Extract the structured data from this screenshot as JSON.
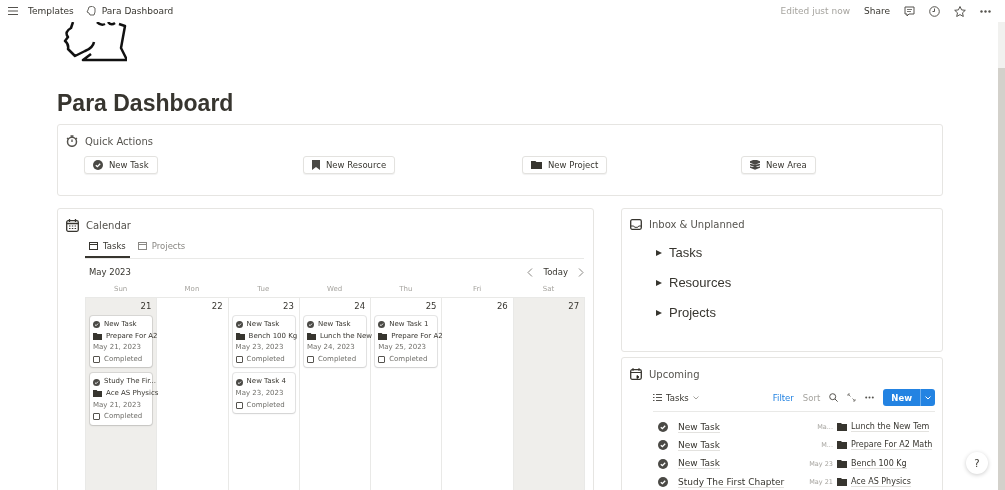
{
  "breadcrumb": [
    {
      "label": "Templates"
    },
    {
      "label": "Para Dashboard"
    }
  ],
  "topbar": {
    "edited": "Edited just now",
    "share": "Share"
  },
  "title": "Para Dashboard",
  "quick_actions": {
    "title": "Quick Actions",
    "buttons": [
      {
        "label": "New Task",
        "kind": "task"
      },
      {
        "label": "New Resource",
        "kind": "resource"
      },
      {
        "label": "New Project",
        "kind": "project"
      },
      {
        "label": "New Area",
        "kind": "area"
      }
    ]
  },
  "calendar": {
    "title": "Calendar",
    "tabs": [
      {
        "label": "Tasks",
        "selected": true
      },
      {
        "label": "Projects",
        "selected": false
      }
    ],
    "month": "May 2023",
    "today": "Today",
    "weekdays": [
      "Sun",
      "Mon",
      "Tue",
      "Wed",
      "Thu",
      "Fri",
      "Sat"
    ],
    "days": [
      {
        "number": "21",
        "weekend": true,
        "events": [
          {
            "title": "New Task",
            "project": "Prepare For A2",
            "date": "May 21, 2023",
            "status": "Completed",
            "checked": false
          },
          {
            "title": "Study The Fir...",
            "project": "Ace AS Physics",
            "date": "May 21, 2023",
            "status": "Completed",
            "checked": false
          }
        ]
      },
      {
        "number": "22",
        "weekend": false
      },
      {
        "number": "23",
        "weekend": false,
        "events": [
          {
            "title": "New Task",
            "project": "Bench 100 Kg",
            "date": "May 23, 2023",
            "status": "Completed",
            "checked": false
          },
          {
            "title": "New Task 4",
            "date": "May 23, 2023",
            "status": "Completed",
            "checked": false
          }
        ]
      },
      {
        "number": "24",
        "weekend": false,
        "events": [
          {
            "title": "New Task",
            "project": "Lunch the New",
            "date": "May 24, 2023",
            "status": "Completed",
            "checked": false
          }
        ]
      },
      {
        "number": "25",
        "weekend": false,
        "events": [
          {
            "title": "New Task 1",
            "project": "Prepare For A2",
            "date": "May 25, 2023",
            "status": "Completed",
            "checked": false
          }
        ]
      },
      {
        "number": "26",
        "weekend": false
      },
      {
        "number": "27",
        "weekend": true
      }
    ]
  },
  "inbox": {
    "title": "Inbox & Unplanned",
    "toggles": [
      {
        "label": "Tasks",
        "expanded": false
      },
      {
        "label": "Resources",
        "expanded": false
      },
      {
        "label": "Projects",
        "expanded": false
      }
    ]
  },
  "upcoming": {
    "title": "Upcoming",
    "view": "Tasks",
    "filter": "Filter",
    "sort": "Sort",
    "new": "New",
    "rows": [
      {
        "title": "New Task",
        "date": "Ma...",
        "project": "Lunch the New Tem"
      },
      {
        "title": "New Task",
        "date": "M...",
        "project": "Prepare For A2 Math"
      },
      {
        "title": "New Task",
        "date": "May 23",
        "project": "Bench 100 Kg"
      },
      {
        "title": "Study The First Chapter",
        "date": "May 21",
        "project": "Ace AS Physics"
      }
    ]
  },
  "help": "?"
}
